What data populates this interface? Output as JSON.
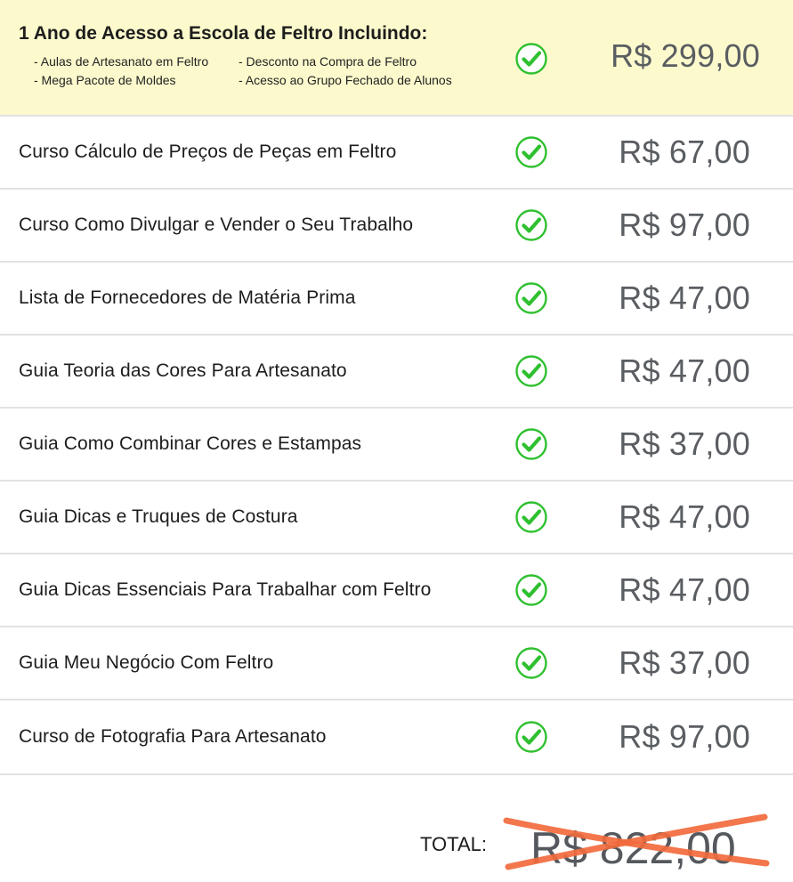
{
  "featured": {
    "title": "1 Ano de Acesso a Escola de Feltro Incluindo:",
    "features": [
      "- Aulas de Artesanato em Feltro",
      "- Desconto na Compra de Feltro",
      "- Mega Pacote de Moldes",
      "- Acesso ao Grupo Fechado de Alunos"
    ],
    "price": "R$ 299,00"
  },
  "items": [
    {
      "title": "Curso Cálculo de Preços de Peças em Feltro",
      "price": "R$ 67,00"
    },
    {
      "title": "Curso Como Divulgar e Vender o Seu Trabalho",
      "price": "R$ 97,00"
    },
    {
      "title": "Lista de Fornecedores de Matéria Prima",
      "price": "R$ 47,00"
    },
    {
      "title": "Guia Teoria das Cores Para Artesanato",
      "price": "R$ 47,00"
    },
    {
      "title": "Guia Como Combinar Cores e Estampas",
      "price": "R$ 37,00"
    },
    {
      "title": "Guia Dicas e Truques de Costura",
      "price": "R$ 47,00"
    },
    {
      "title": "Guia Dicas Essenciais Para Trabalhar com Feltro",
      "price": "R$ 47,00"
    },
    {
      "title": "Guia Meu Negócio Com Feltro",
      "price": "R$ 37,00"
    },
    {
      "title": "Curso de Fotografia Para Artesanato",
      "price": "R$ 97,00"
    }
  ],
  "total": {
    "label": "TOTAL:",
    "price": "R$ 822,00"
  },
  "icons": {
    "check": "check-circle-icon",
    "strike": "strikethrough-x"
  },
  "colors": {
    "featured_bg": "#fcfacd",
    "check_green": "#2fc02f",
    "strike_orange": "#f26a3d",
    "price_gray": "#5a5d61",
    "divider": "#e2e2e2"
  }
}
